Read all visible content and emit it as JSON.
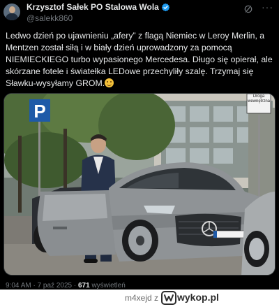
{
  "author": {
    "display_name": "Krzysztof Sałek PO Stalowa Wola",
    "handle": "@salekk860"
  },
  "post": {
    "text": "Ledwo dzień po ujawnieniu „afery” z flagą Niemiec w Leroy Merlin, a Mentzen został siłą i w biały dzień uprowadzony za pomocą NIEMIECKIEGO turbo wypasionego Mercedesa. Długo się opierał, ale skórzane fotele i światełka LEDowe przechyliły szalę. Trzymaj się Sławku-wysyłamy GROM.",
    "emoji": "smiling-face-emoji"
  },
  "photo": {
    "sign_parking": "P",
    "sign_street": "Droga wewnętrzna"
  },
  "meta": {
    "time": "9:04 AM",
    "sep1": " · ",
    "date": "7 paź 2025",
    "sep2": " · ",
    "views_count": "671",
    "views_label": " wyświetleń"
  },
  "watermark": {
    "user": "m4xejd",
    "suffix": "z",
    "site": "wykop.pl"
  },
  "colors": {
    "background": "#000000",
    "text": "#e7e9ea",
    "muted": "#71767b",
    "verified": "#1d9bf0"
  }
}
